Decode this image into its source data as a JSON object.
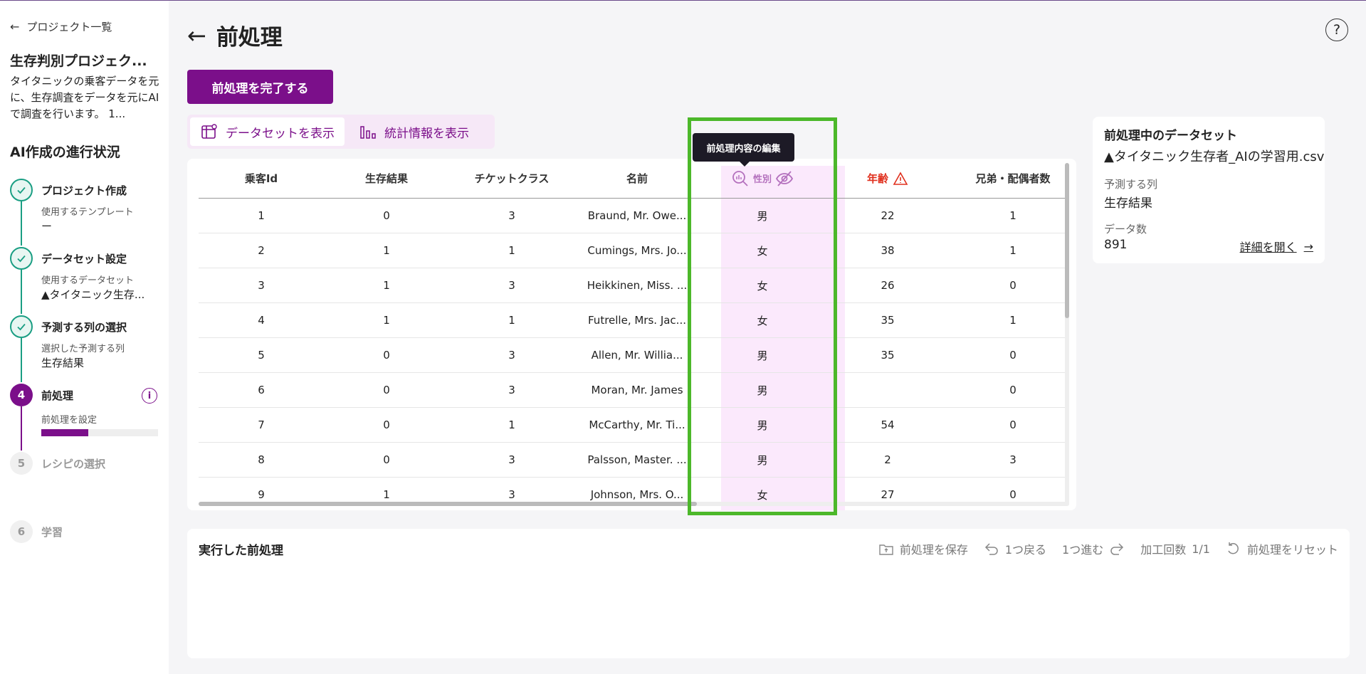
{
  "sidebar": {
    "back_label": "プロジェクト一覧",
    "project_title": "生存判別プロジェク...",
    "project_desc": "タイタニックの乗客データを元に、生存調査をデータを元にAIで調査を行います。 1...",
    "progress_title": "AI作成の進行状況",
    "steps": [
      {
        "num": "",
        "title": "プロジェクト作成",
        "sub": "使用するテンプレート",
        "value": "ー"
      },
      {
        "num": "",
        "title": "データセット設定",
        "sub": "使用するデータセット",
        "value": "▲タイタニック生存..."
      },
      {
        "num": "",
        "title": "予測する列の選択",
        "sub": "選択した予測する列",
        "value": "生存結果"
      },
      {
        "num": "4",
        "title": "前処理",
        "sub": "前処理を設定",
        "value": "",
        "progress": 0.4
      },
      {
        "num": "5",
        "title": "レシピの選択"
      },
      {
        "num": "6",
        "title": "学習"
      }
    ]
  },
  "header": {
    "title": "前処理",
    "complete_button": "前処理を完了する"
  },
  "view_tabs": {
    "dataset": "データセットを表示",
    "stats": "統計情報を表示"
  },
  "table": {
    "columns": [
      "乗客Id",
      "生存結果",
      "チケットクラス",
      "名前",
      "性別",
      "年齢",
      "兄弟・配偶者数"
    ],
    "rows": [
      [
        "1",
        "0",
        "3",
        "Braund, Mr. Owe...",
        "男",
        "22",
        "1"
      ],
      [
        "2",
        "1",
        "1",
        "Cumings, Mrs. Jo...",
        "女",
        "38",
        "1"
      ],
      [
        "3",
        "1",
        "3",
        "Heikkinen, Miss. ...",
        "女",
        "26",
        "0"
      ],
      [
        "4",
        "1",
        "1",
        "Futrelle, Mrs. Jac...",
        "女",
        "35",
        "1"
      ],
      [
        "5",
        "0",
        "3",
        "Allen, Mr. Willia...",
        "男",
        "35",
        "0"
      ],
      [
        "6",
        "0",
        "3",
        "Moran, Mr. James",
        "男",
        "",
        "0"
      ],
      [
        "7",
        "0",
        "1",
        "McCarthy, Mr. Ti...",
        "男",
        "54",
        "0"
      ],
      [
        "8",
        "0",
        "3",
        "Palsson, Master. ...",
        "男",
        "2",
        "3"
      ],
      [
        "9",
        "1",
        "3",
        "Johnson, Mrs. O...",
        "女",
        "27",
        "0"
      ]
    ],
    "tooltip": "前処理内容の編集"
  },
  "info_card": {
    "title": "前処理中のデータセット",
    "file": "▲タイタニック生存者_AIの学習用.csv",
    "target_label": "予測する列",
    "target_value": "生存結果",
    "count_label": "データ数",
    "count_value": "891",
    "details_link": "詳細を開く"
  },
  "exec": {
    "title": "実行した前処理",
    "save": "前処理を保存",
    "undo": "1つ戻る",
    "redo": "1つ進む",
    "count_label": "加工回数",
    "count_value": "1/1",
    "reset": "前処理をリセット"
  },
  "colors": {
    "primary": "#7b0f8a",
    "done": "#1a9e83",
    "warn": "#e0301e",
    "highlight": "#4cb82a"
  }
}
